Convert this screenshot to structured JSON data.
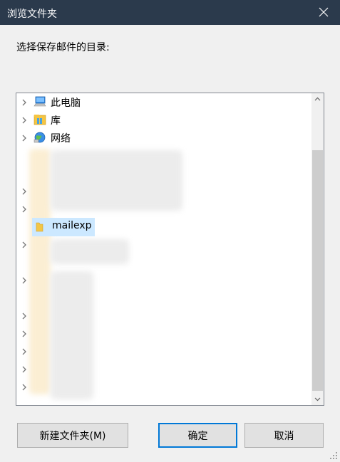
{
  "window": {
    "title": "浏览文件夹"
  },
  "prompt": "选择保存邮件的目录:",
  "tree": {
    "items": [
      {
        "label": "此电脑",
        "icon": "computer-icon"
      },
      {
        "label": "库",
        "icon": "library-icon"
      },
      {
        "label": "网络",
        "icon": "network-icon"
      }
    ],
    "selected": {
      "label": "mailexp",
      "icon": "folder-icon"
    }
  },
  "buttons": {
    "new_folder": "新建文件夹(M)",
    "ok": "确定",
    "cancel": "取消"
  },
  "colors": {
    "titlebar": "#2b3a4c",
    "selection": "#cce8ff",
    "primary_border": "#0078d7"
  }
}
